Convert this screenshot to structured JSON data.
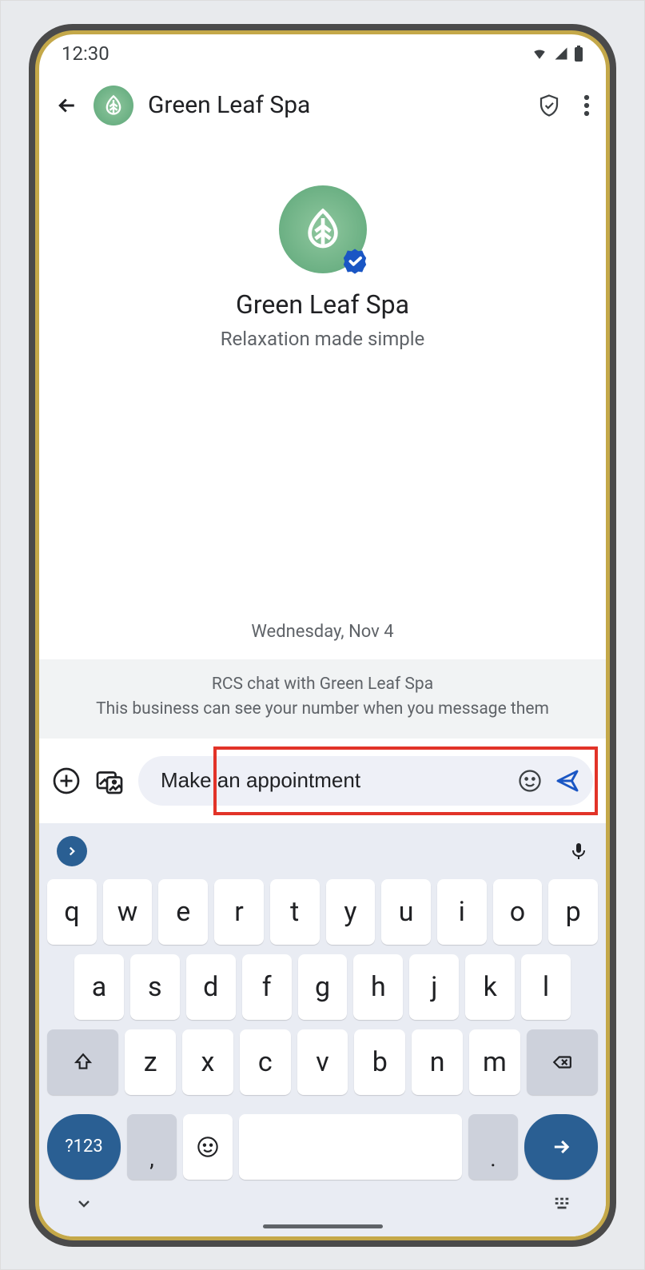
{
  "status": {
    "time": "12:30"
  },
  "header": {
    "title": "Green Leaf Spa"
  },
  "profile": {
    "name": "Green Leaf Spa",
    "tagline": "Relaxation made simple"
  },
  "conversation": {
    "date_label": "Wednesday, Nov 4",
    "info_line1": "RCS chat with Green Leaf Spa",
    "info_line2": "This business can see your number when you message them"
  },
  "compose": {
    "input_value": "Make an appointment"
  },
  "keyboard": {
    "row1": [
      "q",
      "w",
      "e",
      "r",
      "t",
      "y",
      "u",
      "i",
      "o",
      "p"
    ],
    "row2": [
      "a",
      "s",
      "d",
      "f",
      "g",
      "h",
      "j",
      "k",
      "l"
    ],
    "row3": [
      "z",
      "x",
      "c",
      "v",
      "b",
      "n",
      "m"
    ],
    "symbols_key": "?123",
    "comma_key": ",",
    "period_key": "."
  }
}
